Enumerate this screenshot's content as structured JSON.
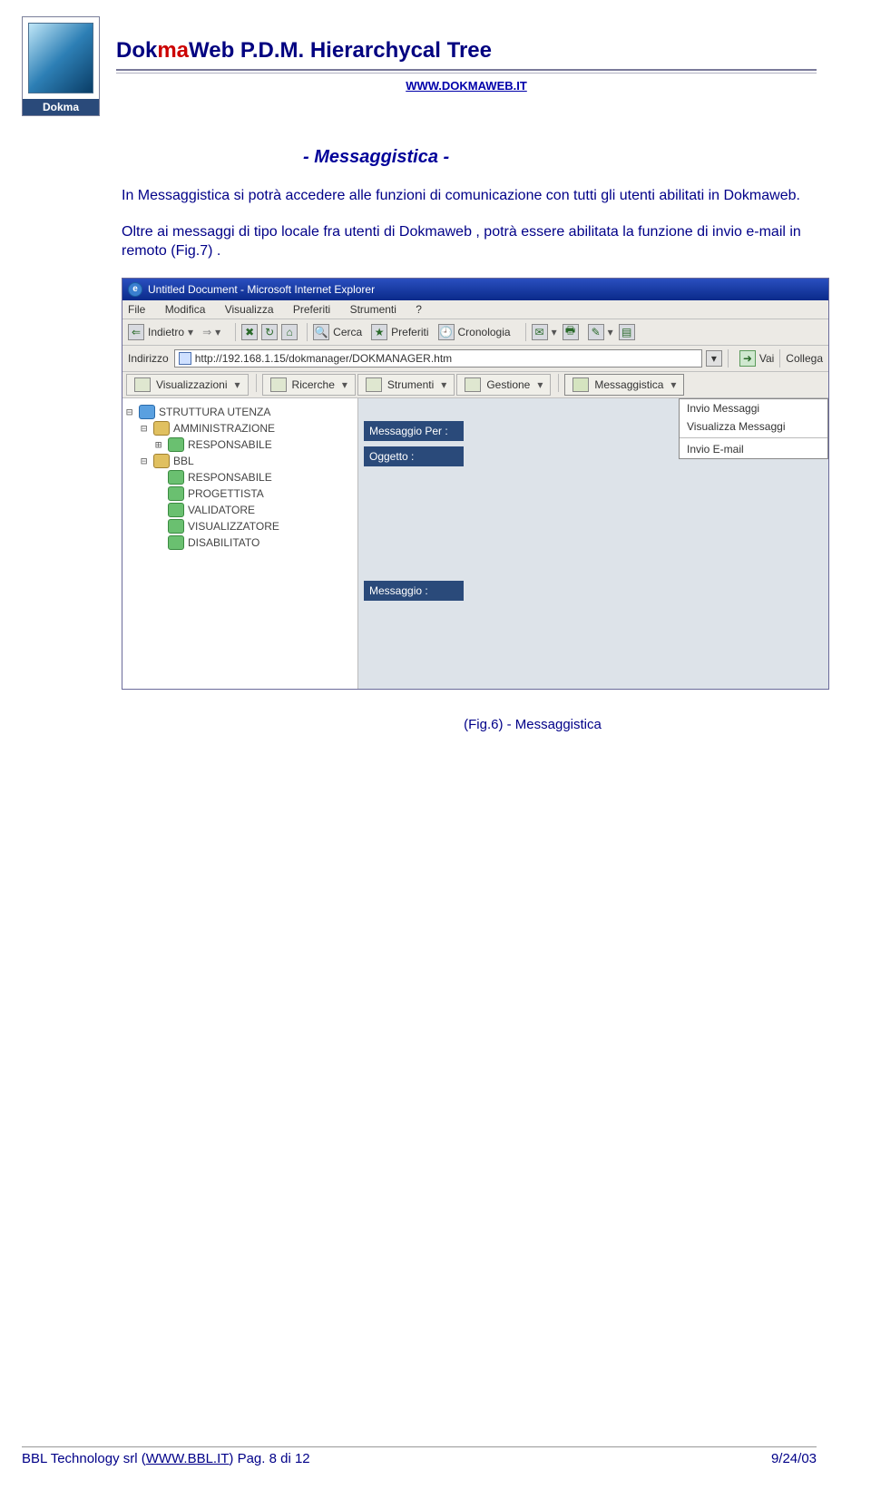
{
  "logo": {
    "brand": "Dokma"
  },
  "header": {
    "title_dok": "Dok",
    "title_ma": "ma",
    "title_web": "Web",
    "title_rest": "  P.D.M.  Hierarchycal Tree",
    "site": "WWW.DOKMAWEB.IT"
  },
  "section_title": "- Messaggistica -",
  "paragraph1": "In Messaggistica si potrà accedere alle funzioni di comunicazione con tutti gli utenti abilitati in Dokmaweb.",
  "paragraph2": "Oltre ai messaggi di tipo locale fra utenti di Dokmaweb , potrà essere abilitata la funzione di invio e-mail in remoto (Fig.7) .",
  "shot": {
    "window_title": "Untitled Document - Microsoft Internet Explorer",
    "menubar": [
      "File",
      "Modifica",
      "Visualizza",
      "Preferiti",
      "Strumenti",
      "?"
    ],
    "toolbar": {
      "back": "Indietro",
      "search": "Cerca",
      "favorites": "Preferiti",
      "history": "Cronologia"
    },
    "addr_label": "Indirizzo",
    "addr_value": "http://192.168.1.15/dokmanager/DOKMANAGER.htm",
    "go": "Vai",
    "links": "Collega",
    "appbar": {
      "viz": "Visualizzazioni",
      "search": "Ricerche",
      "tools": "Strumenti",
      "manage": "Gestione",
      "msg": "Messaggistica"
    },
    "tree": {
      "root": "STRUTTURA UTENZA",
      "n1": "AMMINISTRAZIONE",
      "n1a": "RESPONSABILE",
      "n2": "BBL",
      "n2a": "RESPONSABILE",
      "n2b": "PROGETTISTA",
      "n2c": "VALIDATORE",
      "n2d": "VISUALIZZATORE",
      "n2e": "DISABILITATO"
    },
    "form": {
      "to": "Messaggio Per :",
      "subject": "Oggetto :",
      "body": "Messaggio :"
    },
    "menu": {
      "m1": "Invio Messaggi",
      "m2": "Visualizza Messaggi",
      "m3": "Invio E-mail"
    }
  },
  "caption": "(Fig.6) - Messaggistica",
  "footer": {
    "left_pre": "BBL Technology srl (",
    "left_link": "WWW.BBL.IT",
    "left_post": ")  Pag. 8 di 12",
    "right": "9/24/03"
  }
}
